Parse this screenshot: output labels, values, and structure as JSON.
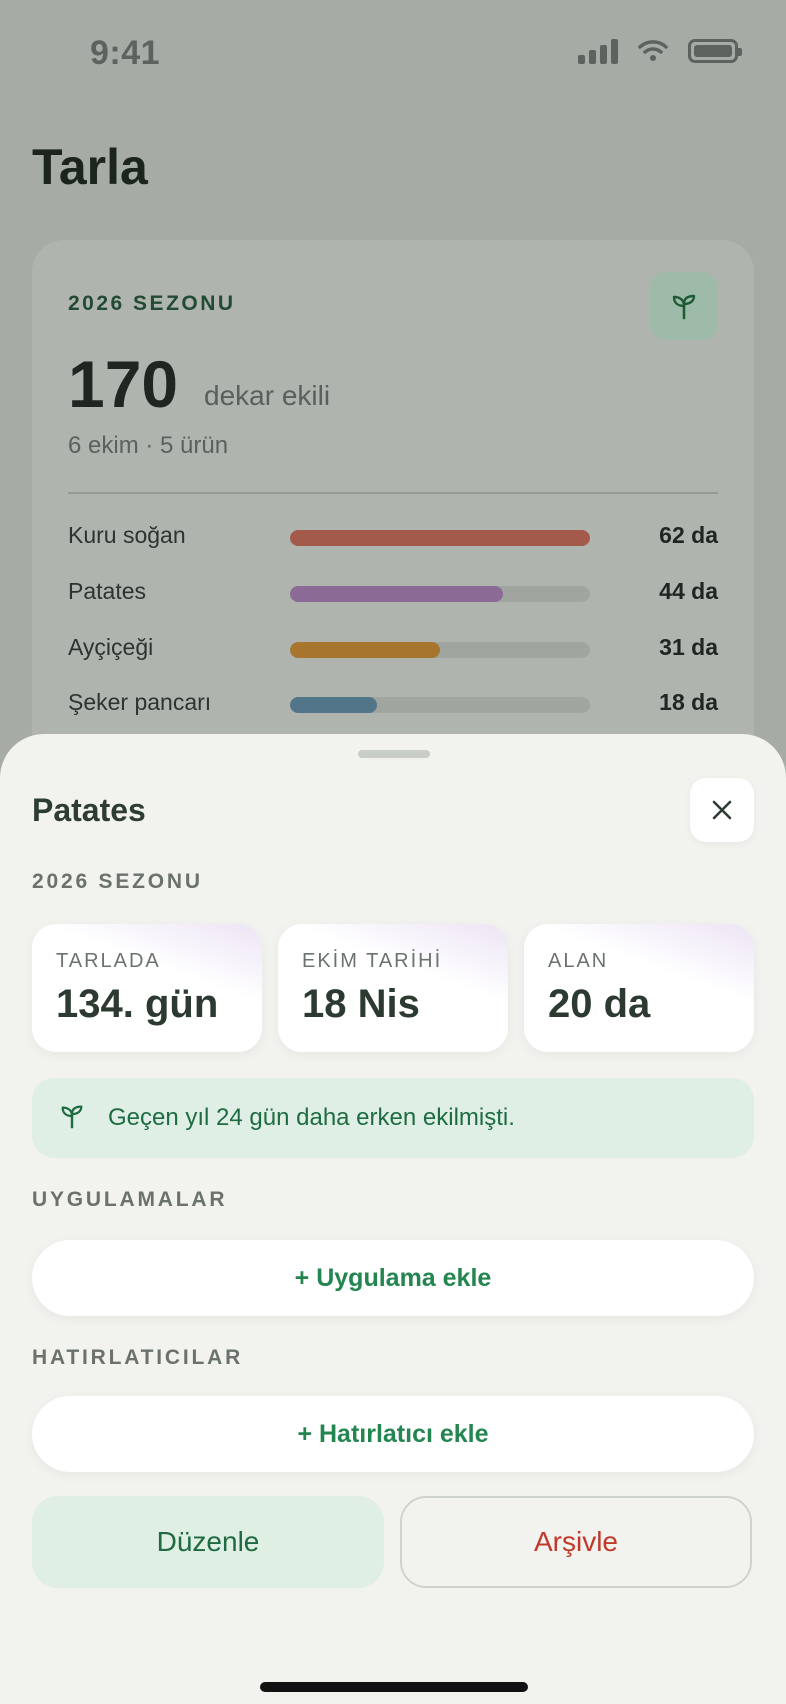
{
  "status_bar": {
    "time": "9:41"
  },
  "background": {
    "page_title": "Tarla",
    "season": {
      "label": "2026 SEZONU",
      "total": "170",
      "unit": "dekar ekili",
      "subtitle": "6 ekim · 5 ürün",
      "icon": "sprout-icon",
      "crops": [
        {
          "name": "Kuru soğan",
          "value": "62 da",
          "fraction": 1.0,
          "color": "#a35a4a"
        },
        {
          "name": "Patates",
          "value": "44 da",
          "fraction": 0.71,
          "color": "#8c6a96"
        },
        {
          "name": "Ayçiçeği",
          "value": "31 da",
          "fraction": 0.5,
          "color": "#a8752f"
        },
        {
          "name": "Şeker pancarı",
          "value": "18 da",
          "fraction": 0.29,
          "color": "#52758a"
        }
      ]
    }
  },
  "sheet": {
    "title": "Patates",
    "close_icon": "close-icon",
    "season_label": "2026 SEZONU",
    "stats": [
      {
        "label": "TARLADA",
        "value": "134. gün"
      },
      {
        "label": "EKİM TARİHİ",
        "value": "18 Nis"
      },
      {
        "label": "ALAN",
        "value": "20 da"
      }
    ],
    "info": {
      "icon": "sprout-icon",
      "text": "Geçen yıl 24 gün daha erken ekilmişti."
    },
    "applications": {
      "label": "UYGULAMALAR",
      "add_label": "+ Uygulama ekle"
    },
    "reminders": {
      "label": "HATIRLATICILAR",
      "add_label": "+ Hatırlatıcı ekle"
    },
    "edit_label": "Düzenle",
    "archive_label": "Arşivle"
  },
  "colors": {
    "accent_green": "#23854f",
    "danger": "#c0392b",
    "sheet_bg": "#f2f3ef"
  }
}
